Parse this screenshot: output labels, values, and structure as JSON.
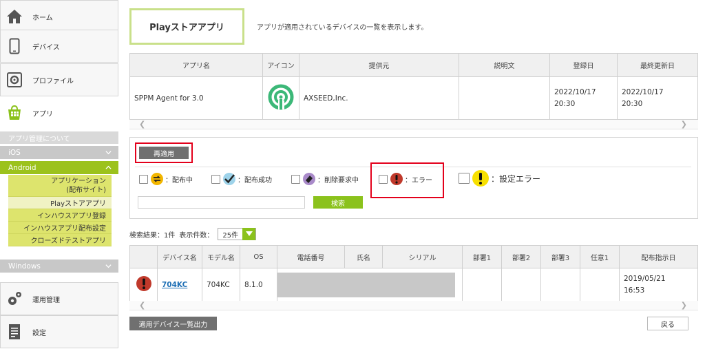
{
  "sidebar": {
    "home": "ホーム",
    "devices": "デバイス",
    "profiles": "プロファイル",
    "apps": "アプリ",
    "about_app_mgmt": "アプリ管理について",
    "ios": "iOS",
    "android": "Android",
    "android_items": {
      "app_dist_line1": "アプリケーション",
      "app_dist_line2": "(配布サイト)",
      "play_store": "Playストアアプリ",
      "inhouse_register": "インハウスアプリ登録",
      "inhouse_dist": "インハウスアプリ配布設定",
      "closed_test": "クローズドテストアプリ"
    },
    "windows": "Windows",
    "operations": "運用管理",
    "settings": "設定"
  },
  "header": {
    "tab_title": "Playストアアプリ",
    "description": "アプリが適用されているデバイスの一覧を表示します。"
  },
  "app_table": {
    "headers": [
      "アプリ名",
      "アイコン",
      "提供元",
      "説明文",
      "登録日",
      "最終更新日"
    ],
    "row": {
      "name": "SPPM Agent for 3.0",
      "provider": "AXSEED,Inc.",
      "description": "",
      "registered": "2022/10/17",
      "registered_time": "20:30",
      "updated": "2022/10/17",
      "updated_time": "20:30"
    }
  },
  "filter": {
    "reapply": "再適用",
    "statuses": {
      "distributing": "：配布中",
      "success": "：配布成功",
      "deleting": "：削除要求中",
      "error": "：エラー",
      "config_error": "：設定エラー"
    },
    "search_placeholder": "",
    "search_button": "検索"
  },
  "results": {
    "summary": "検索結果：1件",
    "per_page_label": "表示件数：",
    "per_page_value": "25件"
  },
  "device_table": {
    "headers": [
      "",
      "デバイス名",
      "モデル名",
      "OS",
      "電話番号",
      "氏名",
      "シリアル",
      "部署1",
      "部署2",
      "部署3",
      "任意1",
      "配布指示日"
    ],
    "row": {
      "device_name": "704KC",
      "model": "704KC",
      "os": "8.1.0",
      "date": "2019/05/21",
      "time": "16:53"
    }
  },
  "footer": {
    "export": "適用デバイス一覧出力",
    "back": "戻る"
  },
  "colors": {
    "accent_green": "#8bc21c",
    "android_active": "#9cc21c",
    "submenu_bg": "#dde46d",
    "highlight_red": "#e3001b",
    "error_icon": "#c0392b"
  }
}
